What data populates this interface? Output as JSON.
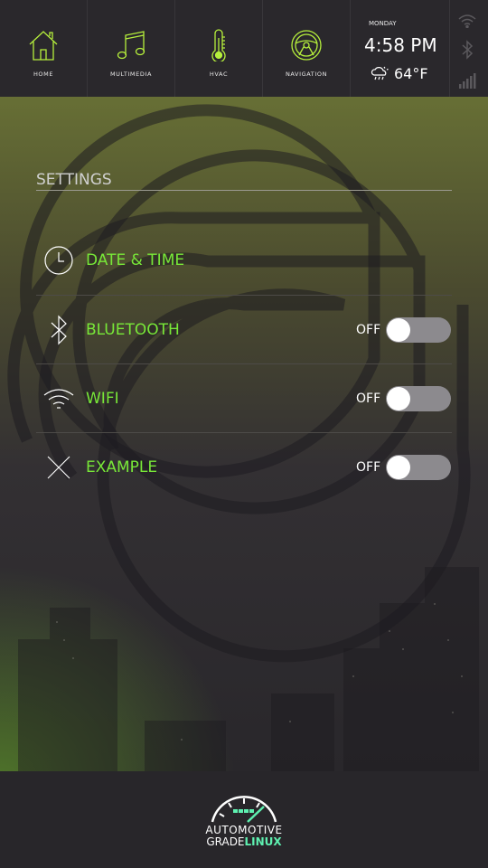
{
  "nav": [
    {
      "label": "HOME",
      "icon": "home-icon"
    },
    {
      "label": "MULTIMEDIA",
      "icon": "music-note-icon"
    },
    {
      "label": "HVAC",
      "icon": "thermometer-icon"
    },
    {
      "label": "NAVIGATION",
      "icon": "steering-wheel-icon"
    }
  ],
  "clock": {
    "day": "MONDAY",
    "time": "4:58 PM",
    "temperature": "64°F",
    "weather_icon": "cloud-rain-sun-icon"
  },
  "status_icons": [
    "wifi-icon",
    "bluetooth-icon",
    "signal-bars-icon"
  ],
  "settings": {
    "title": "SETTINGS",
    "items": [
      {
        "label": "DATE & TIME",
        "icon": "clock-icon",
        "has_toggle": false
      },
      {
        "label": "BLUETOOTH",
        "icon": "bluetooth-icon",
        "toggle_text": "OFF",
        "enabled": false
      },
      {
        "label": "WIFI",
        "icon": "wifi-icon",
        "toggle_text": "OFF",
        "enabled": false
      },
      {
        "label": "EXAMPLE",
        "icon": "x-icon",
        "toggle_text": "OFF",
        "enabled": false
      }
    ]
  },
  "branding": {
    "line1": "AUTOMOTIVE",
    "line2_a": "GRADE",
    "line2_b": "LINUX"
  },
  "colors": {
    "accent_green": "#78e838",
    "icon_green": "#b6f03c",
    "agl_teal": "#5ef0b0",
    "topbar": "#2a282c"
  }
}
